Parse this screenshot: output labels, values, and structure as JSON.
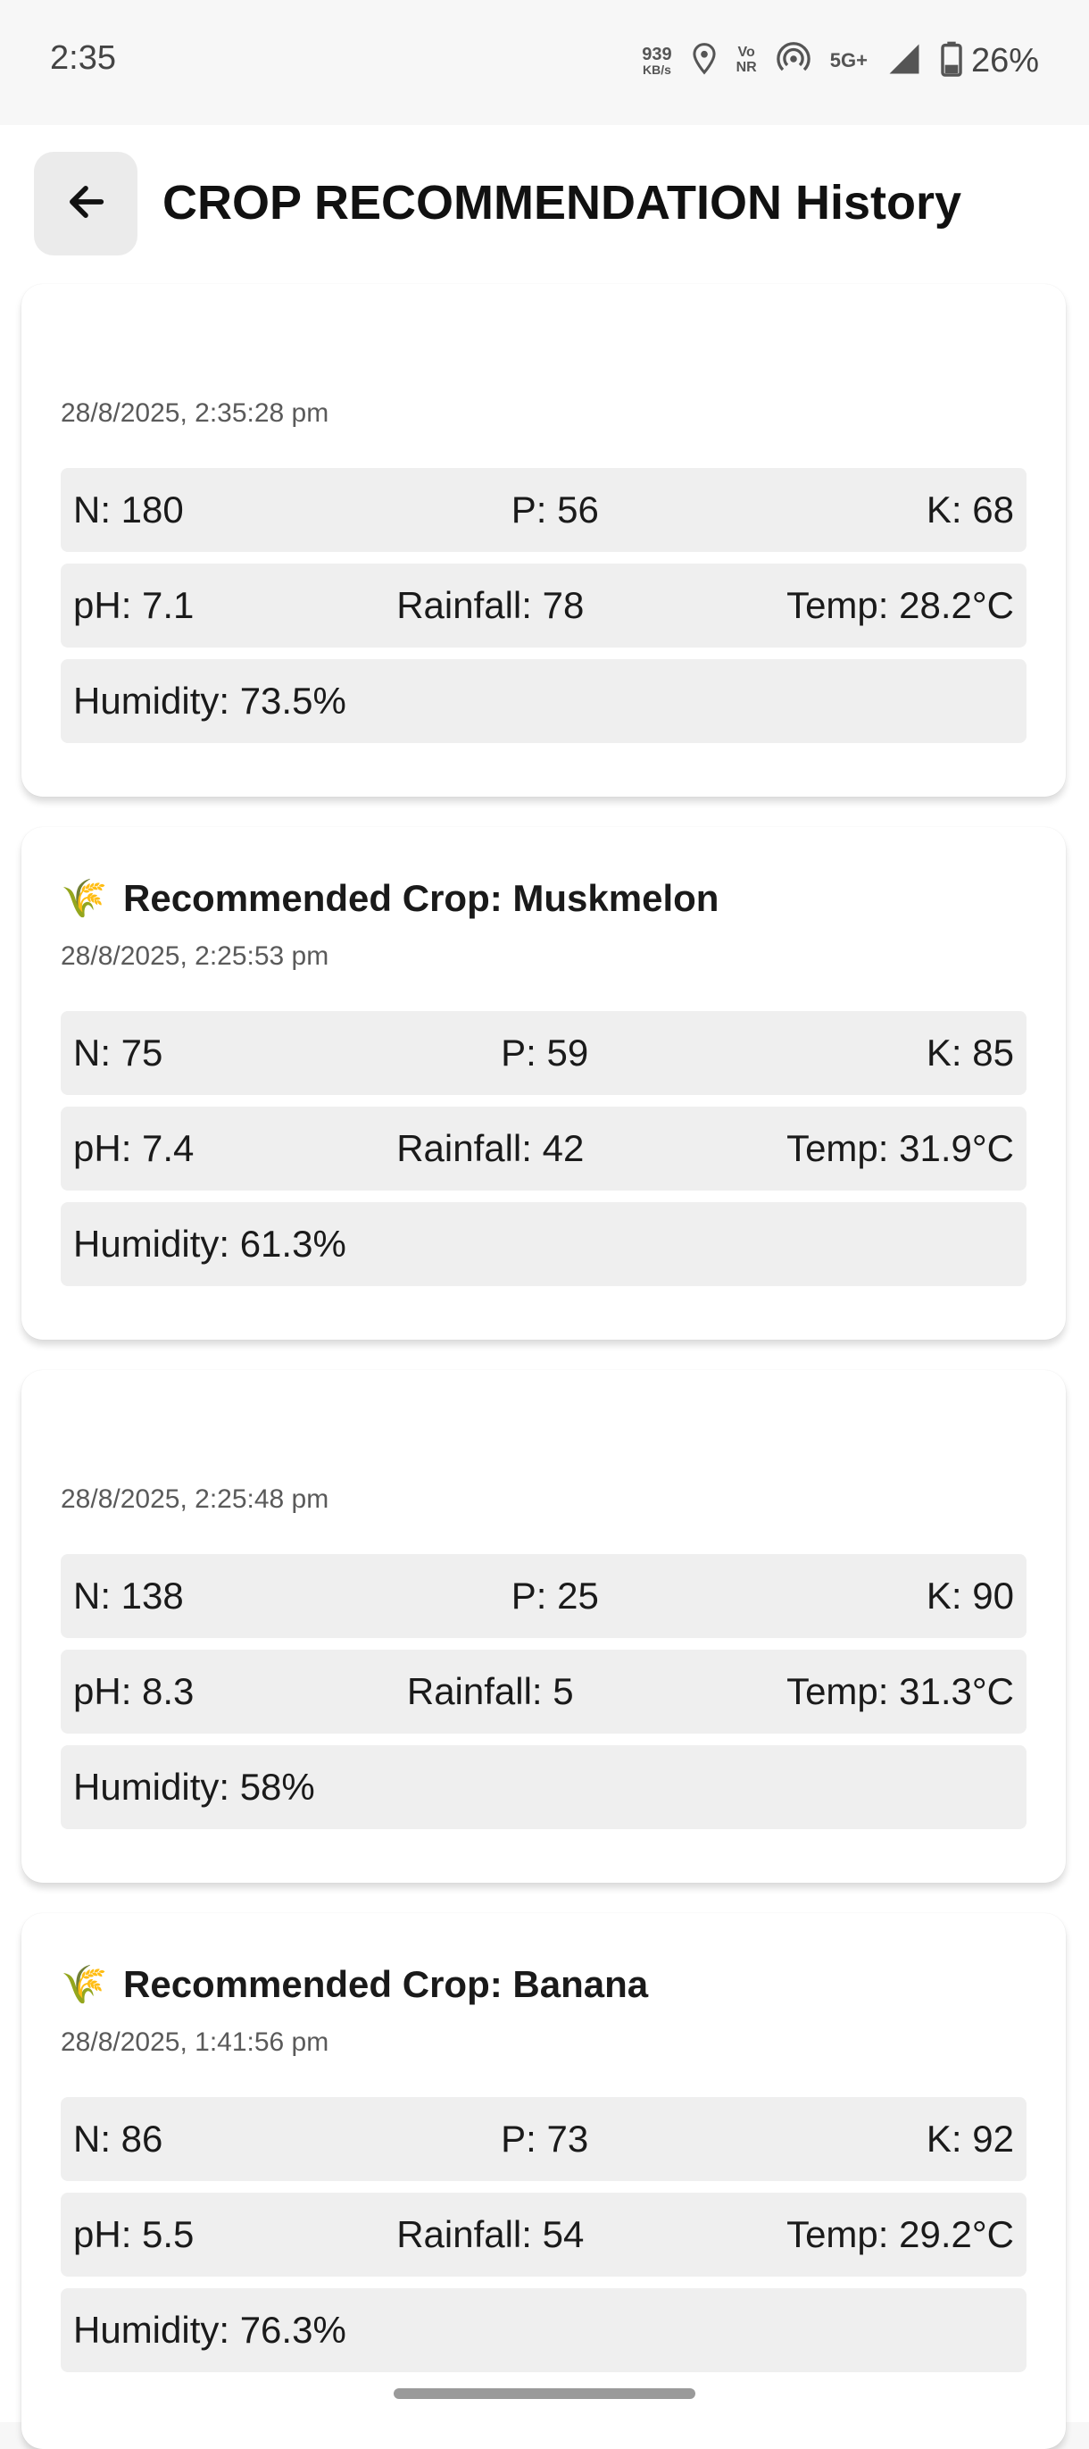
{
  "status_bar": {
    "time": "2:35",
    "net_speed_value": "939",
    "net_speed_unit": "KB/s",
    "vonr_top": "Vo",
    "vonr_bottom": "NR",
    "network": "5G+",
    "battery": "26%"
  },
  "header": {
    "title": "CROP RECOMMENDATION History"
  },
  "records": [
    {
      "crop_icon": "",
      "crop_label": "",
      "timestamp": "28/8/2025, 2:35:28 pm",
      "n": "N: 180",
      "p": "P: 56",
      "k": "K: 68",
      "ph": "pH: 7.1",
      "rainfall": "Rainfall: 78",
      "temp": "Temp: 28.2°C",
      "humidity": "Humidity: 73.5%"
    },
    {
      "crop_icon": "🌾",
      "crop_label": "Recommended Crop: Muskmelon",
      "timestamp": "28/8/2025, 2:25:53 pm",
      "n": "N: 75",
      "p": "P: 59",
      "k": "K: 85",
      "ph": "pH: 7.4",
      "rainfall": "Rainfall: 42",
      "temp": "Temp: 31.9°C",
      "humidity": "Humidity: 61.3%"
    },
    {
      "crop_icon": "",
      "crop_label": "",
      "timestamp": "28/8/2025, 2:25:48 pm",
      "n": "N: 138",
      "p": "P: 25",
      "k": "K: 90",
      "ph": "pH: 8.3",
      "rainfall": "Rainfall: 5",
      "temp": "Temp: 31.3°C",
      "humidity": "Humidity: 58%"
    },
    {
      "crop_icon": "🌾",
      "crop_label": "Recommended Crop: Banana",
      "timestamp": "28/8/2025, 1:41:56 pm",
      "n": "N: 86",
      "p": "P: 73",
      "k": "K: 92",
      "ph": "pH: 5.5",
      "rainfall": "Rainfall: 54",
      "temp": "Temp: 29.2°C",
      "humidity": "Humidity: 76.3%"
    }
  ],
  "icons": {
    "back": "arrow-left-icon",
    "crop": "rice-sheaf-icon"
  }
}
